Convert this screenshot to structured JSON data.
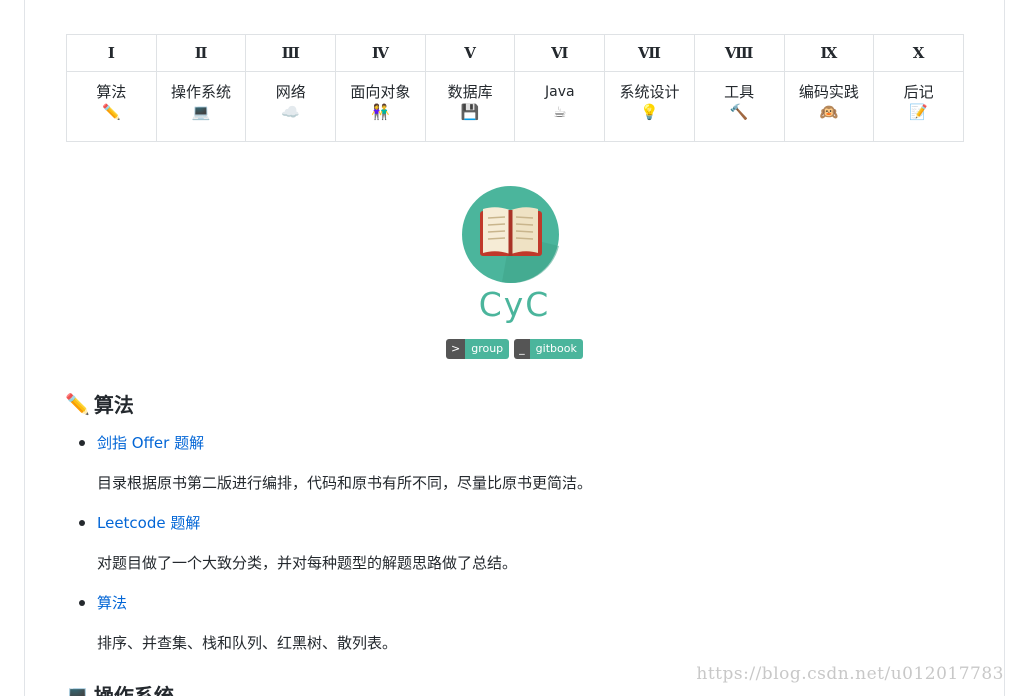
{
  "nav": {
    "headers": [
      "I",
      "Ⅱ",
      "Ⅲ",
      "Ⅳ",
      "V",
      "Ⅵ",
      "Ⅶ",
      "Ⅷ",
      "Ⅸ",
      "X"
    ],
    "cells": [
      {
        "label": "算法",
        "icon": "pencil-icon",
        "glyph": "✏️"
      },
      {
        "label": "操作系统",
        "icon": "laptop-icon",
        "glyph": "💻"
      },
      {
        "label": "网络",
        "icon": "cloud-icon",
        "glyph": "☁️"
      },
      {
        "label": "面向对象",
        "icon": "couple-icon",
        "glyph": "👫"
      },
      {
        "label": "数据库",
        "icon": "floppy-disk-icon",
        "glyph": "💾"
      },
      {
        "label": "Java",
        "icon": "coffee-icon",
        "glyph": "☕"
      },
      {
        "label": "系统设计",
        "icon": "light-bulb-icon",
        "glyph": "💡"
      },
      {
        "label": "工具",
        "icon": "hammer-icon",
        "glyph": "🔨"
      },
      {
        "label": "编码实践",
        "icon": "monkey-icon",
        "glyph": "🙉"
      },
      {
        "label": "后记",
        "icon": "memo-icon",
        "glyph": "📝"
      }
    ]
  },
  "brand": {
    "title": "CyC",
    "logo_icon": "open-book-icon",
    "logo_bg": "#4bb59c",
    "badges": [
      {
        "left": ">",
        "right": "group"
      },
      {
        "left": "_",
        "right": "gitbook"
      }
    ]
  },
  "sections": {
    "algorithms": {
      "icon_glyph": "✏️",
      "title": "算法",
      "items": [
        {
          "link": "剑指 Offer 题解",
          "desc": "目录根据原书第二版进行编排，代码和原书有所不同，尽量比原书更简洁。"
        },
        {
          "link": "Leetcode 题解",
          "desc": "对题目做了一个大致分类，并对每种题型的解题思路做了总结。"
        },
        {
          "link": "算法",
          "desc": "排序、并查集、栈和队列、红黑树、散列表。"
        }
      ]
    },
    "os": {
      "icon_glyph": "💻",
      "title": "操作系统"
    }
  },
  "watermark": "https://blog.csdn.net/u012017783",
  "colors": {
    "accent": "#4bb59c",
    "link": "#0366d6",
    "badge_dark": "#555555"
  }
}
